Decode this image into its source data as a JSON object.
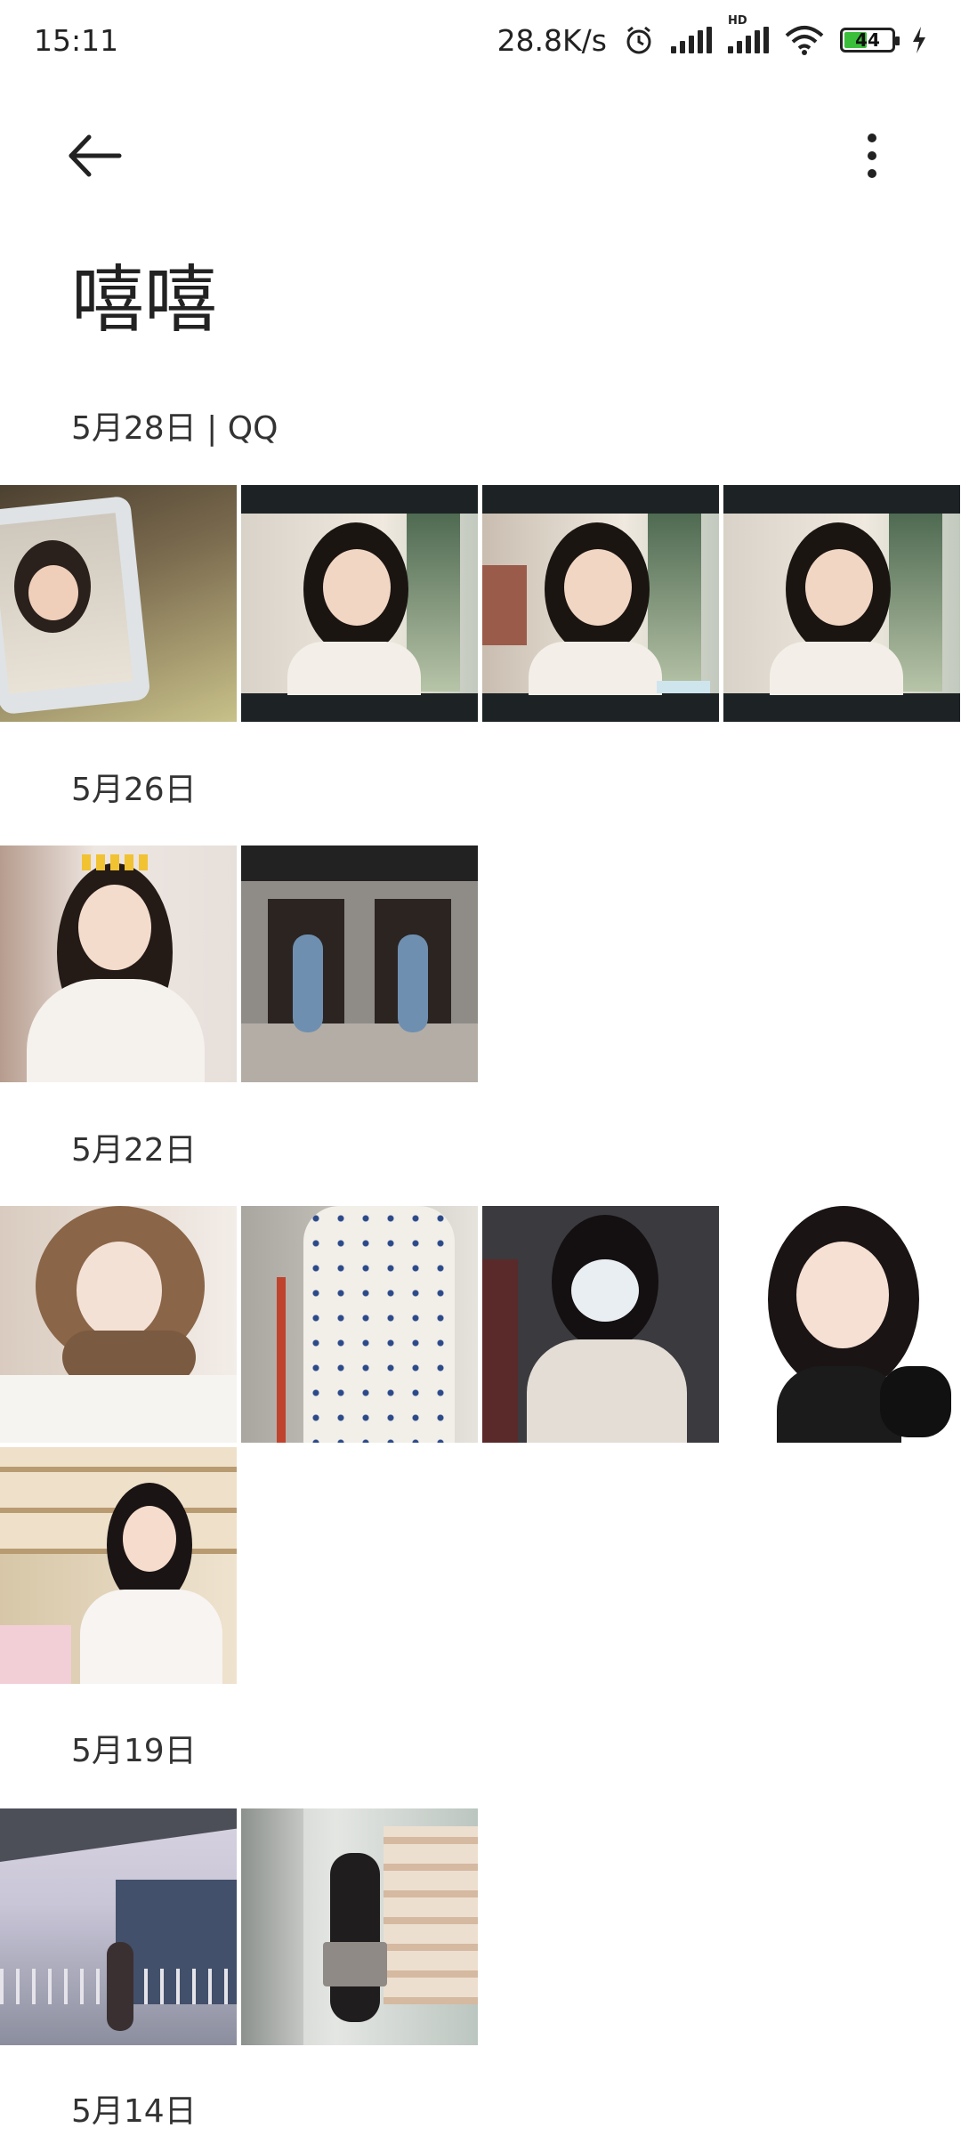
{
  "status_bar": {
    "time": "15:11",
    "network_speed": "28.8K/s",
    "hd_label": "HD",
    "battery": "44",
    "icons": [
      "alarm-icon",
      "signal-icon",
      "hd-signal-icon",
      "wifi-icon",
      "battery-icon",
      "charging-icon"
    ]
  },
  "header": {
    "back_icon": "arrow-left-icon",
    "more_icon": "more-vertical-icon",
    "title": "嘻嘻"
  },
  "sections": [
    {
      "date": "5月28日 | QQ",
      "photo_count": 4
    },
    {
      "date": "5月26日",
      "photo_count": 2
    },
    {
      "date": "5月22日",
      "photo_count": 5
    },
    {
      "date": "5月19日",
      "photo_count": 2
    },
    {
      "date": "5月14日",
      "photo_count": 0
    }
  ],
  "colors": {
    "background": "#ffffff",
    "text": "#222222",
    "battery_fill": "#3bbf3b"
  }
}
